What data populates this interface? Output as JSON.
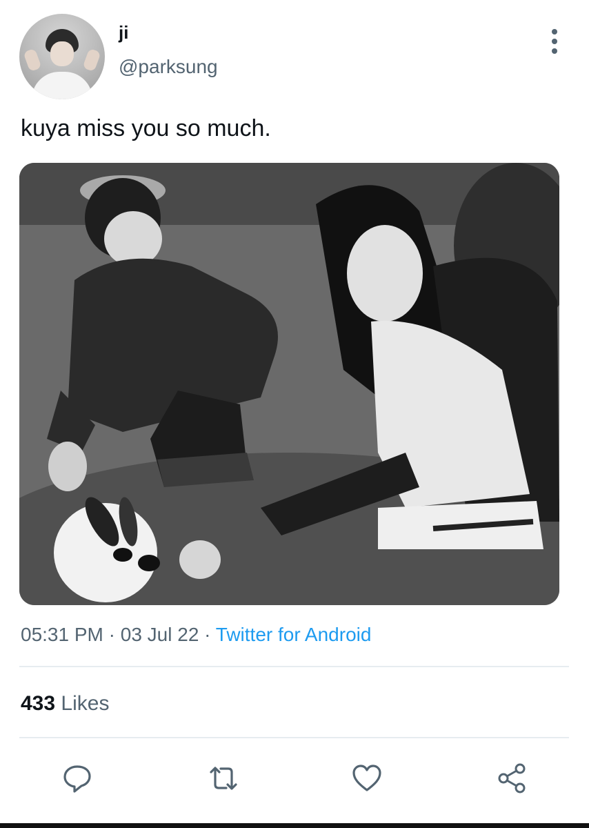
{
  "user": {
    "display_name": "ji",
    "handle": "@parksung",
    "avatar": "avatar"
  },
  "tweet": {
    "text": "kuya miss you so much.",
    "time": "05:31 PM",
    "date": "03 Jul 22",
    "source": "Twitter for Android",
    "separator": "·"
  },
  "stats": {
    "likes_count": "433",
    "likes_label": "Likes"
  },
  "icons": {
    "more": "more-vertical-icon",
    "reply": "reply-icon",
    "retweet": "retweet-icon",
    "like": "heart-icon",
    "share": "share-icon"
  },
  "colors": {
    "text": "#0f1419",
    "secondary": "#536471",
    "accent": "#1d9bf0",
    "divider": "#e6ecf0"
  }
}
